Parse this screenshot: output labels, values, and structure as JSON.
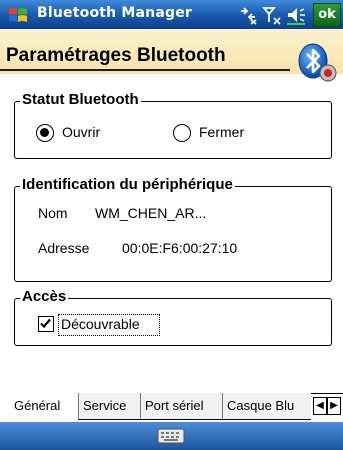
{
  "titlebar": {
    "app_title": "Bluetooth Manager",
    "ok_label": "ok",
    "icons": [
      "windows-start-icon",
      "connectivity-icon",
      "signal-icon",
      "volume-icon"
    ],
    "bg_color": "#1d5fb4"
  },
  "header": {
    "title": "Paramétrages Bluetooth",
    "logo": "bluetooth-icon",
    "bg_color": "#f7e3a8"
  },
  "status_group": {
    "title": "Statut Bluetooth",
    "options": [
      {
        "label": "Ouvrir",
        "selected": true
      },
      {
        "label": "Fermer",
        "selected": false
      }
    ]
  },
  "device_group": {
    "title": "Identification du périphérique",
    "name_label": "Nom",
    "name_value": "WM_CHEN_AR...",
    "address_label": "Adresse",
    "address_value": "00:0E:F6:00:27:10"
  },
  "access_group": {
    "title": "Accès",
    "checkbox_label": "Découvrable",
    "checked": true
  },
  "tabs": {
    "items": [
      "Général",
      "Service",
      "Port sériel",
      "Casque Blu"
    ],
    "active": "Général"
  },
  "bottombar": {
    "icon": "keyboard-icon",
    "bg_color": "#1b559f"
  }
}
